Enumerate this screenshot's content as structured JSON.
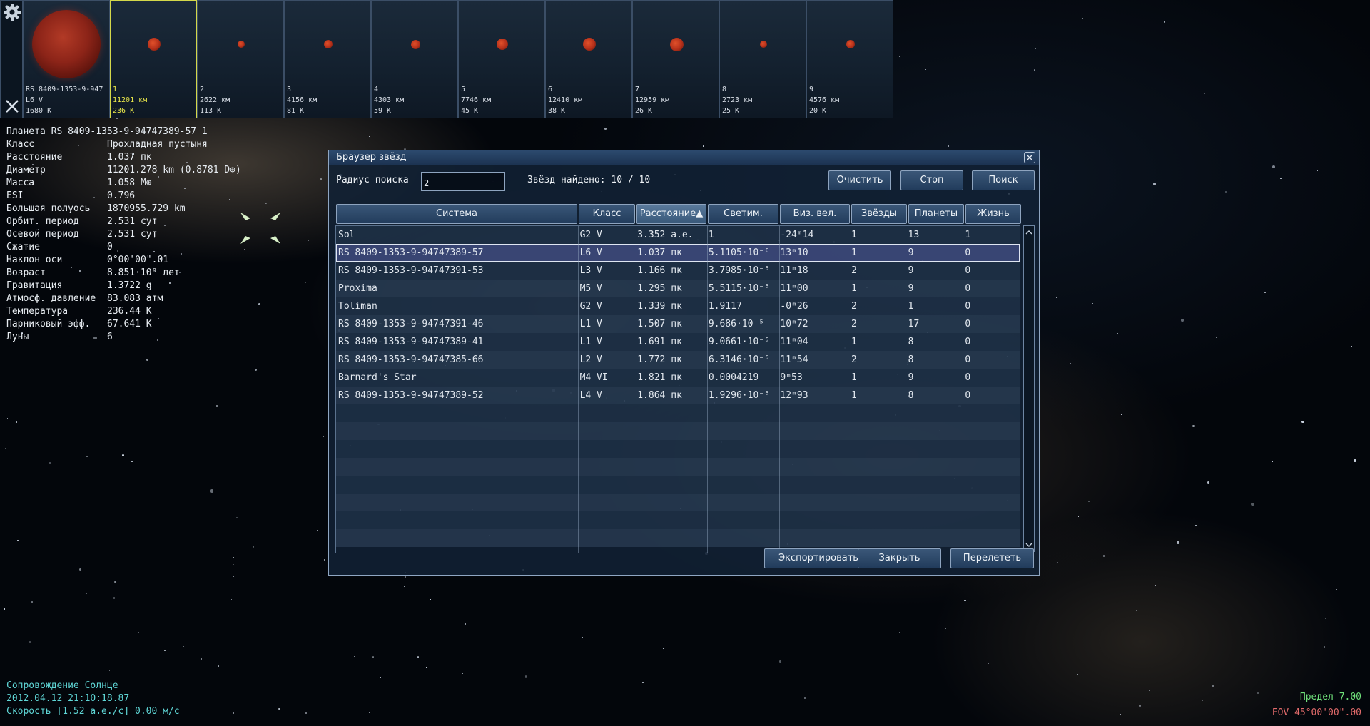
{
  "strip": {
    "host": {
      "name": "RS 8409-1353-9-947",
      "class": "L6 V",
      "temp": "1680 K"
    },
    "planets": [
      {
        "num": "1",
        "size": "11201 км",
        "temp": "236 K",
        "selected": true
      },
      {
        "num": "2",
        "size": "2622 км",
        "temp": "113 K",
        "selected": false
      },
      {
        "num": "3",
        "size": "4156 км",
        "temp": "81 K",
        "selected": false
      },
      {
        "num": "4",
        "size": "4303 км",
        "temp": "59 K",
        "selected": false
      },
      {
        "num": "5",
        "size": "7746 км",
        "temp": "45 K",
        "selected": false
      },
      {
        "num": "6",
        "size": "12410 км",
        "temp": "38 K",
        "selected": false
      },
      {
        "num": "7",
        "size": "12959 км",
        "temp": "26 K",
        "selected": false
      },
      {
        "num": "8",
        "size": "2723 км",
        "temp": "25 K",
        "selected": false
      },
      {
        "num": "9",
        "size": "4576 км",
        "temp": "20 K",
        "selected": false
      }
    ],
    "icons": {
      "settings": "gear-icon",
      "close": "close-icon"
    }
  },
  "info": {
    "header": "Планета  RS 8409-1353-9-94747389-57 1",
    "rows": [
      {
        "k": "Класс",
        "v": "Прохладная пустыня"
      },
      {
        "k": "Расстояние",
        "v": "1.037 пк"
      },
      {
        "k": "Диаметр",
        "v": "11201.278 km (0.8781 D⊕)"
      },
      {
        "k": "Масса",
        "v": "1.058 M⊕"
      },
      {
        "k": "ESI",
        "v": "0.796"
      },
      {
        "k": "Большая полуось",
        "v": "1870955.729 km"
      },
      {
        "k": "Орбит. период",
        "v": "2.531 сут"
      },
      {
        "k": "Осевой период",
        "v": "2.531 сут"
      },
      {
        "k": "Сжатие",
        "v": "0"
      },
      {
        "k": "Наклон оси",
        "v": "0°00'00\".01"
      },
      {
        "k": "Возраст",
        "v": "8.851·10⁹ лет"
      },
      {
        "k": "Гравитация",
        "v": "1.3722 g"
      },
      {
        "k": "Атмосф. давление",
        "v": "83.083 атм"
      },
      {
        "k": "Температура",
        "v": "236.44 K"
      },
      {
        "k": "Парниковый эфф.",
        "v": "67.641 K"
      },
      {
        "k": "Луны",
        "v": "6"
      }
    ]
  },
  "status": {
    "follow": "Сопровождение Солнце",
    "datetime": "2012.04.12 21:10:18.87",
    "speed": "Скорость [1.52 а.е./с] 0.00 м/с",
    "limit": "Предел     7.00",
    "fov": "FOV 45°00'00\".00"
  },
  "window": {
    "title": "Браузер звёзд",
    "search_label": "Радиус поиска",
    "radius_value": "2",
    "found": "Звёзд найдено: 10 / 10",
    "buttons": {
      "clear": "Очистить",
      "stop": "Стоп",
      "search": "Поиск",
      "export": "Экспортировать",
      "close": "Закрыть",
      "goto": "Перелететь"
    },
    "columns": [
      "Система",
      "Класс",
      "Расстояние▲",
      "Светим.",
      "Виз. вел.",
      "Звёзды",
      "Планеты",
      "Жизнь"
    ],
    "rows": [
      [
        "Sol",
        "G2 V",
        "3.352 а.е.",
        "1",
        "-24ᵐ14",
        "1",
        "13",
        "1"
      ],
      [
        "RS 8409-1353-9-94747389-57",
        "L6 V",
        "1.037 пк",
        "5.1105·10⁻⁶",
        "13ᵐ10",
        "1",
        "9",
        "0"
      ],
      [
        "RS 8409-1353-9-94747391-53",
        "L3 V",
        "1.166 пк",
        "3.7985·10⁻⁵",
        "11ᵐ18",
        "2",
        "9",
        "0"
      ],
      [
        "Proxima",
        "M5 V",
        "1.295 пк",
        "5.5115·10⁻⁵",
        "11ᵐ00",
        "1",
        "9",
        "0"
      ],
      [
        "Toliman",
        "G2 V",
        "1.339 пк",
        "1.9117",
        "-0ᵐ26",
        "2",
        "1",
        "0"
      ],
      [
        "RS 8409-1353-9-94747391-46",
        "L1 V",
        "1.507 пк",
        "9.686·10⁻⁵",
        "10ᵐ72",
        "2",
        "17",
        "0"
      ],
      [
        "RS 8409-1353-9-94747389-41",
        "L1 V",
        "1.691 пк",
        "9.0661·10⁻⁵",
        "11ᵐ04",
        "1",
        "8",
        "0"
      ],
      [
        "RS 8409-1353-9-94747385-66",
        "L2 V",
        "1.772 пк",
        "6.3146·10⁻⁵",
        "11ᵐ54",
        "2",
        "8",
        "0"
      ],
      [
        "Barnard's Star",
        "M4 VI",
        "1.821 пк",
        "0.0004219",
        "9ᵐ53",
        "1",
        "9",
        "0"
      ],
      [
        "RS 8409-1353-9-94747389-52",
        "L4 V",
        "1.864 пк",
        "1.9296·10⁻⁵",
        "12ᵐ93",
        "1",
        "8",
        "0"
      ]
    ],
    "selected_row": 1
  }
}
